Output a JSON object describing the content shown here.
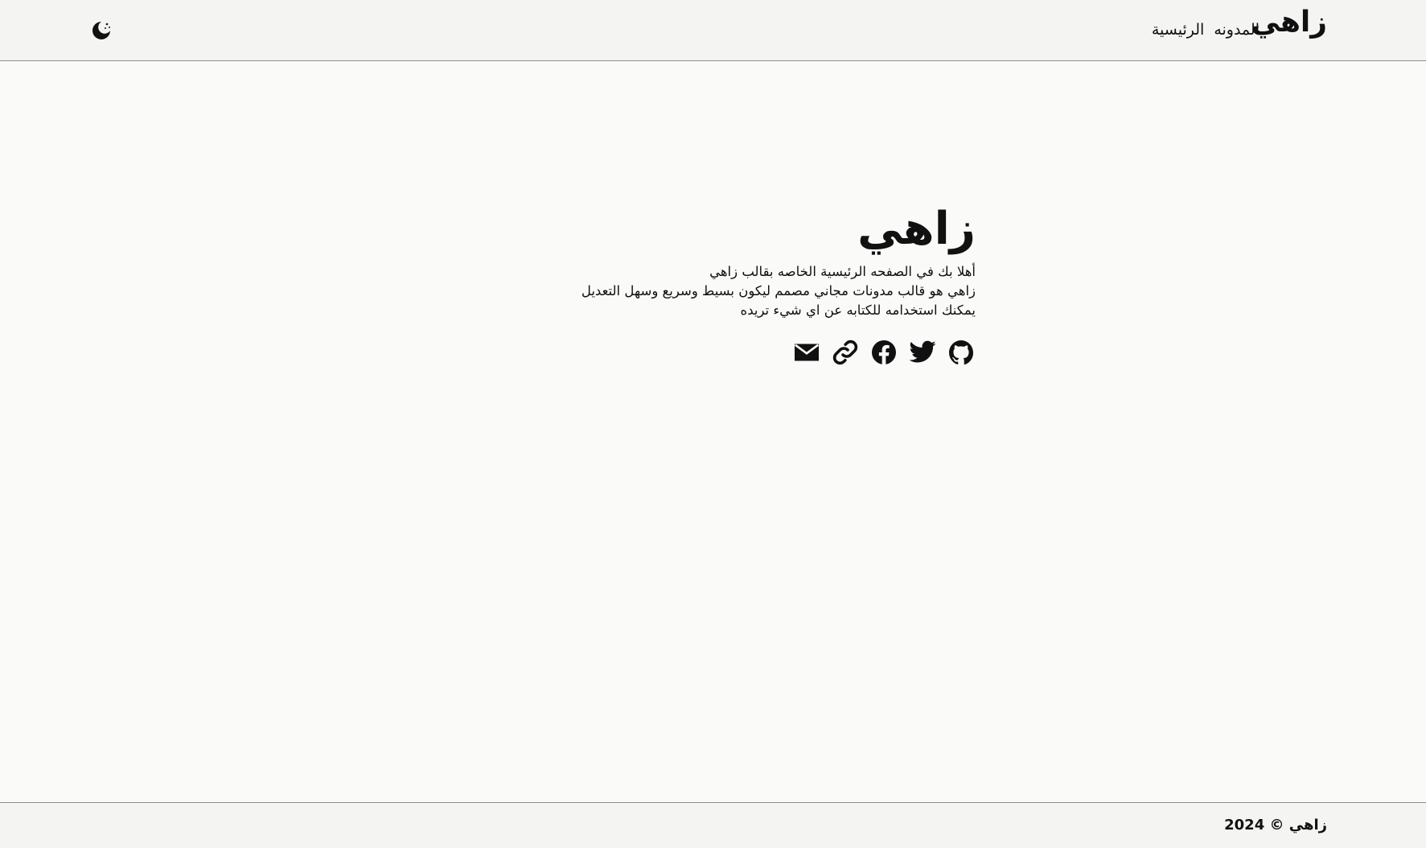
{
  "header": {
    "brand": "زاهي",
    "nav": [
      {
        "label": "الرئيسية"
      },
      {
        "label": "المدونه"
      }
    ],
    "theme_toggle_icon": "moon-stars-icon"
  },
  "hero": {
    "title": "زاهي",
    "lines": [
      "أهلا بك في الصفحه الرئيسية الخاصه بقالب زاهي",
      "زاهي هو قالب مدونات مجاني مصمم ليكون بسيط وسريع وسهل التعديل",
      "يمكنك استخدامه للكتابه عن اي شيء تريده"
    ]
  },
  "social_links": [
    {
      "icon": "github-icon"
    },
    {
      "icon": "twitter-icon"
    },
    {
      "icon": "facebook-icon"
    },
    {
      "icon": "link-icon"
    },
    {
      "icon": "mail-icon"
    }
  ],
  "footer": {
    "text": "زاهي © 2024"
  },
  "colors": {
    "background": "#fafaf9",
    "bar_background": "#f4f4f3",
    "text": "#111111",
    "border": "#8f8f8f"
  }
}
